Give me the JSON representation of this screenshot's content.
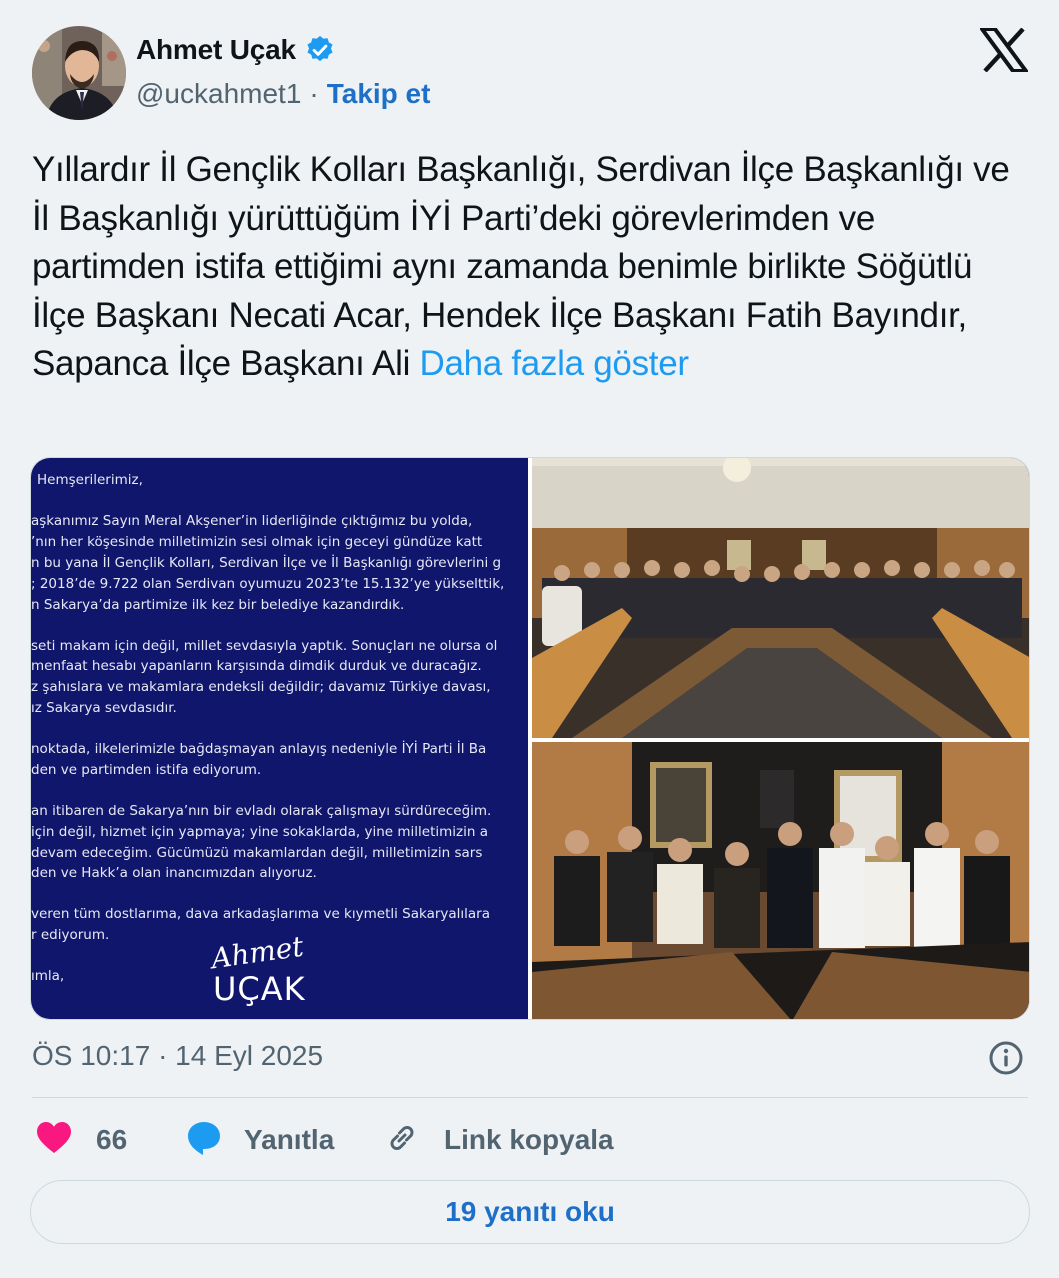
{
  "author": {
    "name": "Ahmet Uçak",
    "handle": "@uckahmet1",
    "separator": "·",
    "follow_label": "Takip et"
  },
  "tweet": {
    "text": "Yıllardır İl Gençlik Kolları Başkanlığı, Serdivan İlçe Başkanlığı ve İl Başkanlığı yürüttüğüm İYİ Parti’deki görevlerimden ve partimden istifa ettiğimi aynı zamanda benimle birlikte Söğütlü İlçe Başkanı Necati Acar, Hendek İlçe Başkanı Fatih Bayındır, Sapanca İlçe Başkanı Ali",
    "more_label": "Daha fazla göster"
  },
  "letter": {
    "lines": [
      "Hemşerilerimiz,",
      "aşkanımız Sayın Meral Akşener’in liderliğinde çıktığımız bu yolda,",
      "’nın her köşesinde milletimizin sesi olmak için geceyi gündüze katt",
      "n bu yana İl Gençlik Kolları, Serdivan İlçe ve İl Başkanlığı görevlerini g",
      "; 2018’de 9.722 olan Serdivan oyumuzu 2023’te 15.132’ye yükselttik,",
      "n Sakarya’da partimize ilk kez bir belediye kazandırdık.",
      "seti makam için değil, millet sevdasıyla yaptık. Sonuçları ne olursa ol",
      "menfaat hesabı yapanların karşısında dimdik durduk ve duracağız.",
      "z şahıslara ve makamlara endeksli değildir; davamız Türkiye davası,",
      "ız Sakarya sevdasıdır.",
      "noktada, ilkelerimizle bağdaşmayan anlayış nedeniyle İYİ Parti İl Ba",
      "den ve partimden istifa ediyorum.",
      "an itibaren de Sakarya’nın bir evladı olarak çalışmayı sürdüreceğim.",
      "için değil, hizmet için yapmaya; yine sokaklarda, yine milletimizin a",
      "devam edeceğim. Gücümüzü makamlardan değil, milletimizin sars",
      "den ve Hakk’a olan inancımızdan alıyoruz.",
      "veren tüm dostlarıma, dava arkadaşlarıma ve kıymetli Sakaryalılara",
      "r ediyorum.",
      "ımla,"
    ],
    "signature_script": "Ahmet",
    "signature_name": "UÇAK"
  },
  "meta": {
    "timestamp": "ÖS 10:17 · 14 Eyl 2025"
  },
  "actions": {
    "like_count": "66",
    "reply_label": "Yanıtla",
    "copy_label": "Link kopyala"
  },
  "replies_button": "19 yanıtı oku",
  "icons": {
    "verified": "verified-badge-icon",
    "x_logo": "x-logo-icon",
    "info": "info-icon",
    "heart": "heart-icon",
    "reply": "reply-bubble-icon",
    "link": "link-icon"
  },
  "colors": {
    "accent": "#1d9bf0",
    "follow": "#1d6fc7",
    "heart": "#f91880",
    "letter_bg": "#10166b",
    "muted": "#536471"
  }
}
